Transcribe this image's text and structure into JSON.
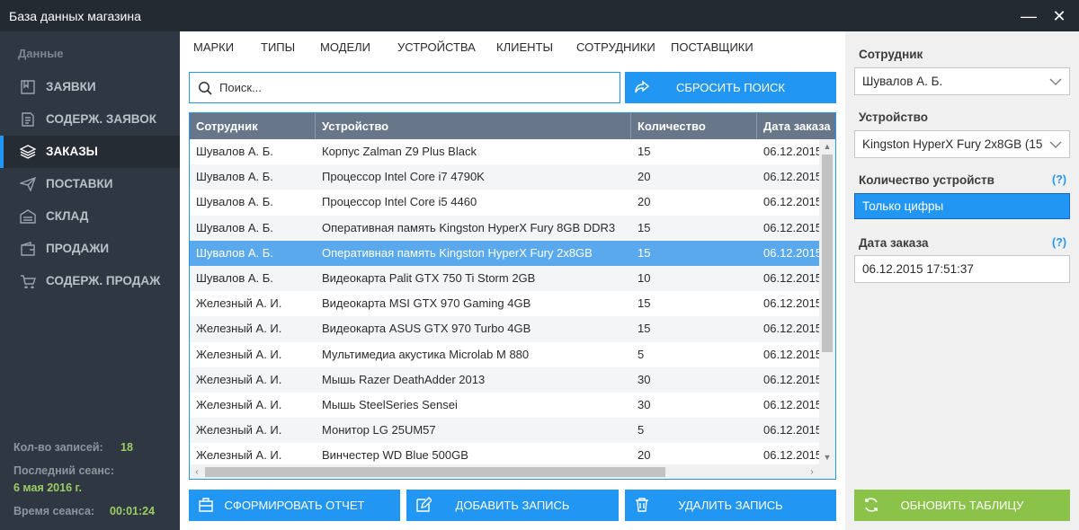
{
  "window": {
    "title": "База данных магазина",
    "minimize": "—",
    "close": "✕"
  },
  "sidebar": {
    "section": "Данные",
    "items": [
      {
        "label": "ЗАЯВКИ",
        "icon": "bookmark-icon"
      },
      {
        "label": "СОДЕРЖ. ЗАЯВОК",
        "icon": "document-icon"
      },
      {
        "label": "ЗАКАЗЫ",
        "icon": "layers-icon",
        "active": true
      },
      {
        "label": "ПОСТАВКИ",
        "icon": "send-icon"
      },
      {
        "label": "СКЛАД",
        "icon": "warehouse-icon"
      },
      {
        "label": "ПРОДАЖИ",
        "icon": "wallet-icon"
      },
      {
        "label": "СОДЕРЖ. ПРОДАЖ",
        "icon": "cart-icon"
      }
    ],
    "stats": {
      "records_label": "Кол-во записей:",
      "records_value": "18",
      "last_session_label": "Последний сеанс:",
      "last_session_value": "6 мая 2016 г.",
      "session_time_label": "Время сеанса:",
      "session_time_value": "00:01:24"
    }
  },
  "tabs": [
    "МАРКИ",
    "ТИПЫ",
    "МОДЕЛИ",
    "УСТРОЙСТВА",
    "КЛИЕНТЫ",
    "СОТРУДНИКИ",
    "ПОСТАВЩИКИ"
  ],
  "search": {
    "placeholder": "Поиск...",
    "reset_label": "СБРОСИТЬ ПОИСК"
  },
  "table": {
    "columns": [
      "Сотрудник",
      "Устройство",
      "Количество",
      "Дата заказа"
    ],
    "rows": [
      [
        "Шувалов А. Б.",
        "Корпус Zalman Z9 Plus Black",
        "15",
        "06.12.2015"
      ],
      [
        "Шувалов А. Б.",
        "Процессор Intel Core i7 4790K",
        "20",
        "06.12.2015"
      ],
      [
        "Шувалов А. Б.",
        "Процессор Intel Core i5 4460",
        "20",
        "06.12.2015"
      ],
      [
        "Шувалов А. Б.",
        "Оперативная память Kingston HyperX Fury 8GB DDR3",
        "15",
        "06.12.2015"
      ],
      [
        "Шувалов А. Б.",
        "Оперативная память Kingston HyperX Fury 2x8GB",
        "15",
        "06.12.2015"
      ],
      [
        "Шувалов А. Б.",
        "Видеокарта Palit GTX 750 Ti Storm 2GB",
        "10",
        "06.12.2015"
      ],
      [
        "Железный А. И.",
        "Видеокарта MSI GTX 970 Gaming 4GB",
        "15",
        "06.12.2015"
      ],
      [
        "Железный А. И.",
        "Видеокарта ASUS GTX 970 Turbo 4GB",
        "15",
        "06.12.2015"
      ],
      [
        "Железный А. И.",
        "Мультимедиа акустика Microlab M 880",
        "5",
        "06.12.2015"
      ],
      [
        "Железный А. И.",
        "Мышь Razer DeathAdder 2013",
        "30",
        "06.12.2015"
      ],
      [
        "Железный А. И.",
        "Мышь SteelSeries Sensei",
        "30",
        "06.12.2015"
      ],
      [
        "Железный А. И.",
        "Монитор LG 25UM57",
        "5",
        "06.12.2015"
      ],
      [
        "Железный А. И.",
        "Винчестер WD Blue 500GB",
        "20",
        "06.12.2015"
      ]
    ],
    "selected_row": 4
  },
  "actions": {
    "report": "СФОРМИРОВАТЬ ОТЧЕТ",
    "add": "ДОБАВИТЬ ЗАПИСЬ",
    "delete": "УДАЛИТЬ ЗАПИСЬ",
    "refresh": "ОБНОВИТЬ ТАБЛИЦУ"
  },
  "form": {
    "employee_label": "Сотрудник",
    "employee_value": "Шувалов А. Б.",
    "device_label": "Устройство",
    "device_value": "Kingston HyperX Fury 2x8GB (15",
    "qty_label": "Количество устройств",
    "qty_value": "Только цифры",
    "date_label": "Дата заказа",
    "date_value": "06.12.2015 17:51:37",
    "help": "(?)"
  },
  "colors": {
    "accent": "#2196f3",
    "sidebar": "#2f3842",
    "green": "#8bc34a",
    "header": "#677689"
  }
}
